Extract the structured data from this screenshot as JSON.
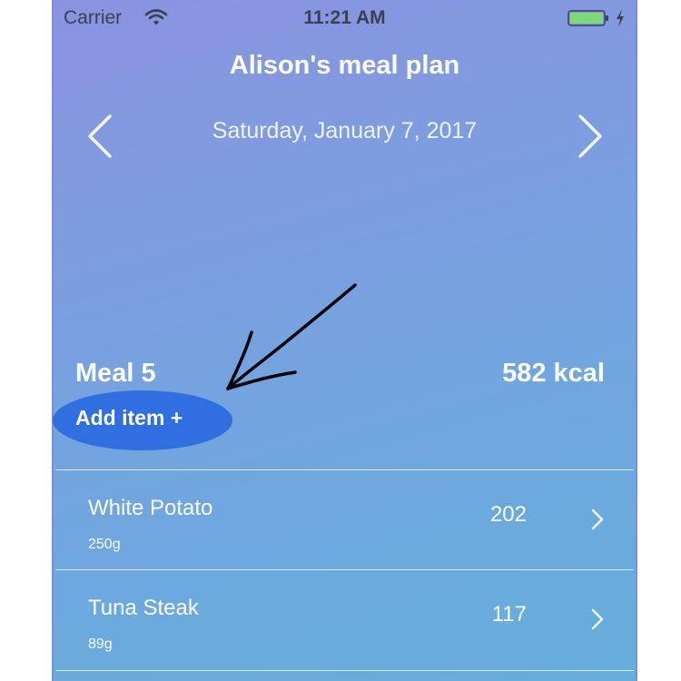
{
  "status_bar": {
    "carrier": "Carrier",
    "time": "11:21 AM",
    "battery_color": "#7ed87a"
  },
  "header": {
    "title": "Alison's meal plan",
    "date": "Saturday, January 7, 2017"
  },
  "meal": {
    "title": "Meal 5",
    "kcal": "582 kcal",
    "add_item_label": "Add item +",
    "add_item_color": "#2f6fdf"
  },
  "items": [
    {
      "name": "White Potato",
      "weight": "250g",
      "kcal": "202"
    },
    {
      "name": "Tuna Steak",
      "weight": "89g",
      "kcal": "117"
    }
  ],
  "icons": {
    "wifi": "wifi-icon",
    "battery": "battery-icon",
    "charging": "charging-bolt-icon",
    "prev": "chevron-left-icon",
    "next": "chevron-right-icon",
    "row": "chevron-right-icon",
    "annotation": "hand-drawn-arrow-icon"
  }
}
